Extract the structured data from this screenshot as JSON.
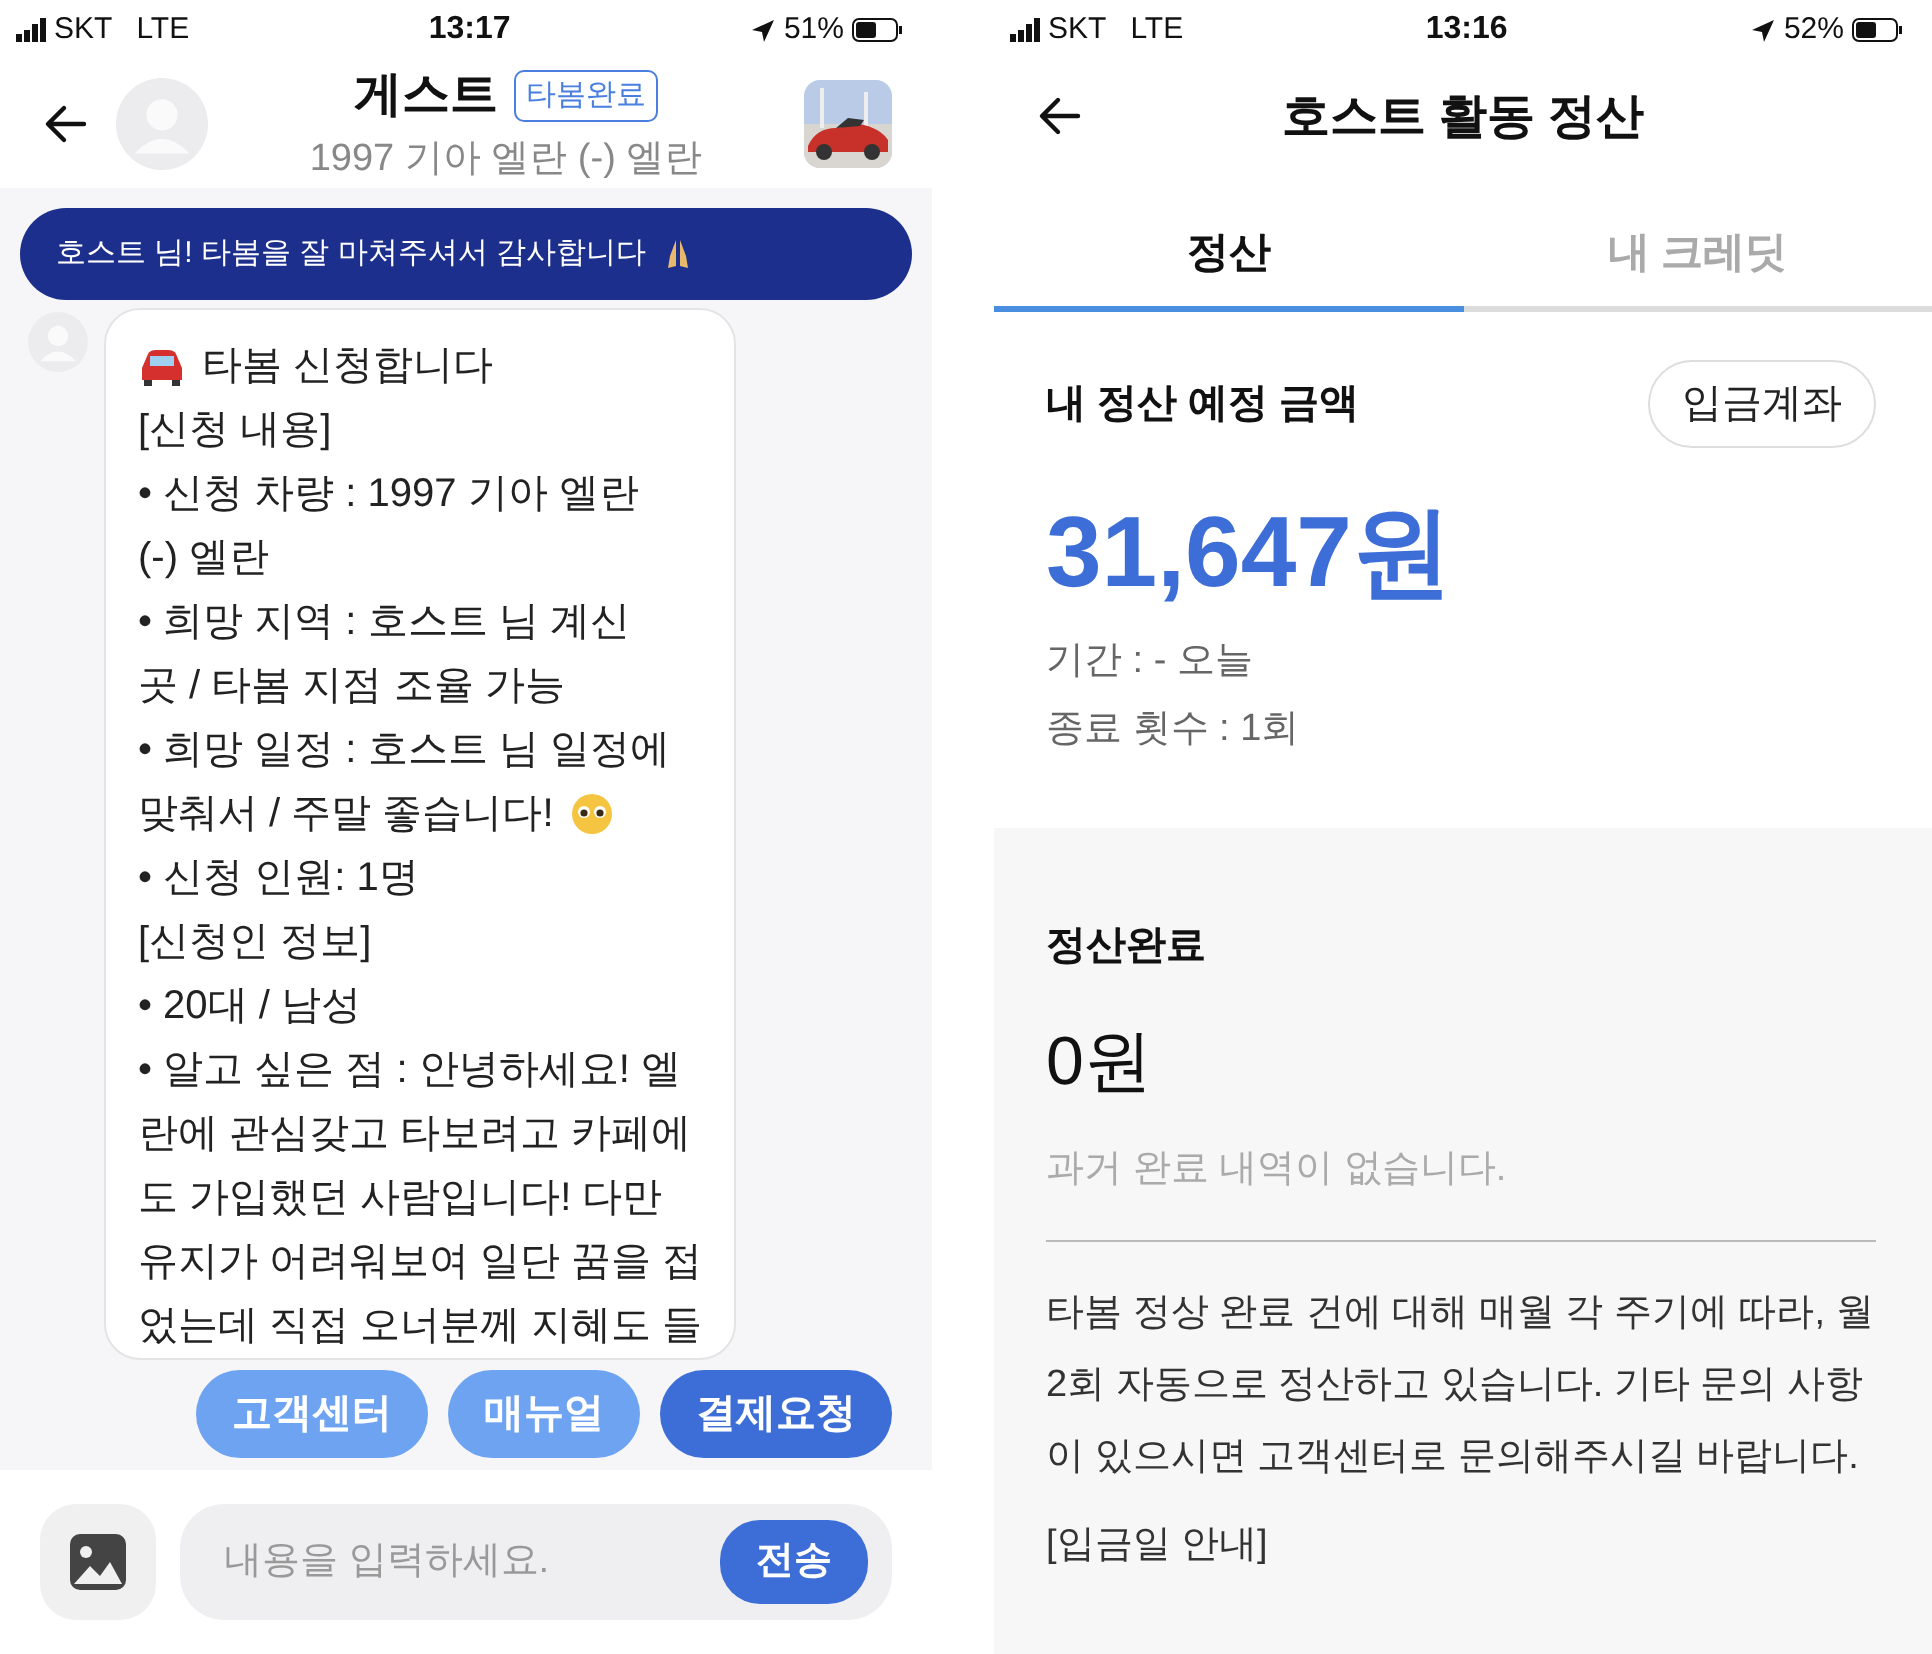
{
  "chat_screen": {
    "status_bar": {
      "carrier": "SKT",
      "network": "LTE",
      "time": "13:17",
      "battery": "51%"
    },
    "header": {
      "title": "게스트",
      "badge": "타봄완료",
      "subtitle": "1997 기아 엘란 (-) 엘란"
    },
    "banner": "호스트 님! 타봄을 잘 마쳐주셔서 감사합니다",
    "message": {
      "title": "타봄 신청합니다",
      "lines": [
        {
          "text": "[신청 내용]",
          "kind": "plain"
        },
        {
          "text": "• 신청 차량 : 1997 기아 엘란",
          "kind": "plain"
        },
        {
          "text": "(-) 엘란",
          "kind": "plain"
        },
        {
          "text": "• 희망 지역 : 호스트 님 계신",
          "kind": "plain"
        },
        {
          "text": "곳 / 타봄 지점 조율 가능",
          "kind": "plain"
        },
        {
          "text": "• 희망 일정 : 호스트 님 일정에",
          "kind": "plain"
        },
        {
          "text": "맞춰서 / 주말 좋습니다!",
          "kind": "emoji"
        },
        {
          "text": "• 신청 인원: 1명",
          "kind": "plain"
        },
        {
          "text": "[신청인 정보]",
          "kind": "plain"
        },
        {
          "text": "• 20대 / 남성",
          "kind": "plain"
        },
        {
          "text": "• 알고 싶은 점 : 안녕하세요! 엘",
          "kind": "plain"
        },
        {
          "text": "란에 관심갖고 타보려고 카페에",
          "kind": "plain"
        },
        {
          "text": "도 가입했던 사람입니다! 다만",
          "kind": "plain"
        },
        {
          "text": "유지가 어려워보여 일단 꿈을 접",
          "kind": "plain"
        },
        {
          "text": "었는데 직접 오너분께 지혜도 들",
          "kind": "plain"
        }
      ]
    },
    "quick_buttons": [
      {
        "label": "고객센터",
        "kind": "light"
      },
      {
        "label": "매뉴얼",
        "kind": "light"
      },
      {
        "label": "결제요청",
        "kind": "primary"
      }
    ],
    "input": {
      "placeholder": "내용을 입력하세요.",
      "send": "전송"
    }
  },
  "settlement_screen": {
    "status_bar": {
      "carrier": "SKT",
      "network": "LTE",
      "time": "13:16",
      "battery": "52%"
    },
    "title": "호스트 활동 정산",
    "tabs": [
      {
        "label": "정산",
        "selected": true
      },
      {
        "label": "내 크레딧",
        "selected": false
      }
    ],
    "expected": {
      "label": "내 정산 예정 금액",
      "button": "입금계좌",
      "amount": "31,647원",
      "period": "기간 :  - 오늘",
      "count": "종료 횟수 : 1회"
    },
    "completed": {
      "label": "정산완료",
      "amount": "0원",
      "empty": "과거 완료 내역이 없습니다.",
      "notice": "타봄 정상 완료 건에 대해 매월 각 주기에 따라, 월 2회 자동으로 정산하고 있습니다. 기타 문의 사항이 있으시면 고객센터로 문의해주시길 바랍니다.",
      "notice_heading": "[입금일 안내]"
    }
  }
}
